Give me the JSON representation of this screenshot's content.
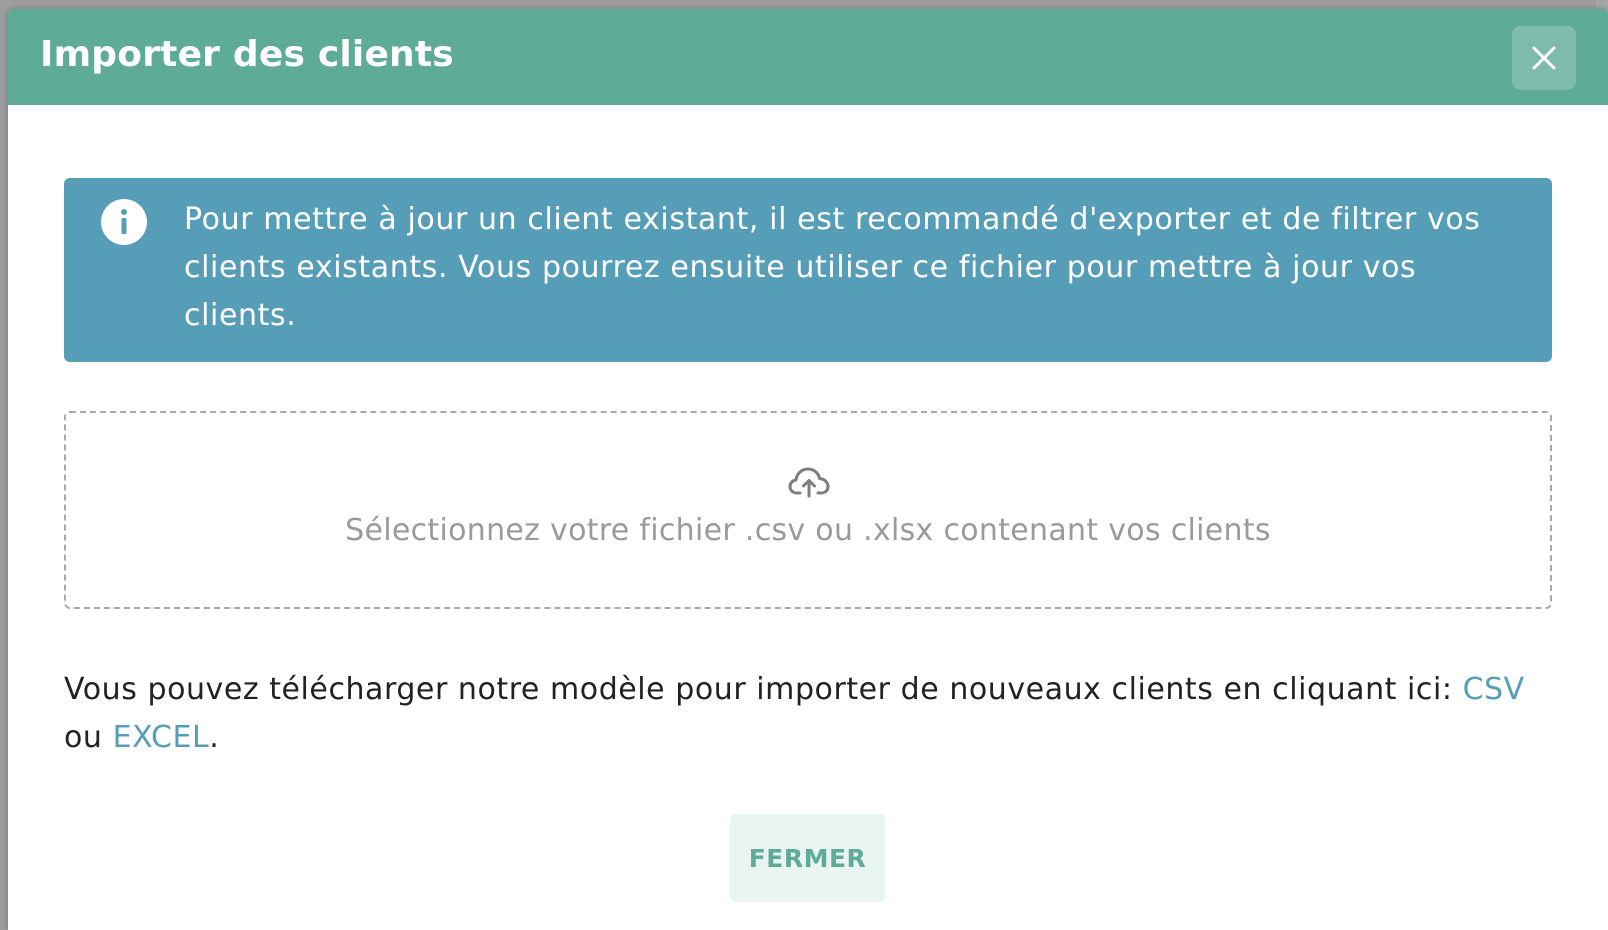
{
  "modal": {
    "title": "Importer des clients",
    "close_icon": "close-icon",
    "colors": {
      "header": "#5eab98",
      "info_banner": "#569db8",
      "link": "#569db8"
    }
  },
  "info": {
    "icon": "info-icon",
    "text": "Pour mettre à jour un client existant, il est recommandé d'exporter et de filtrer vos clients existants. Vous pourrez ensuite utiliser ce fichier pour mettre à jour vos clients."
  },
  "dropzone": {
    "icon": "cloud-upload-icon",
    "text": "Sélectionnez votre fichier .csv ou .xlsx contenant vos clients"
  },
  "template": {
    "text_before": "Vous pouvez télécharger notre modèle pour importer de nouveaux clients en cliquant ici: ",
    "csv_link": "CSV",
    "text_between": " ou ",
    "excel_link": "EXCEL",
    "text_after": "."
  },
  "footer": {
    "close_label": "FERMER"
  }
}
